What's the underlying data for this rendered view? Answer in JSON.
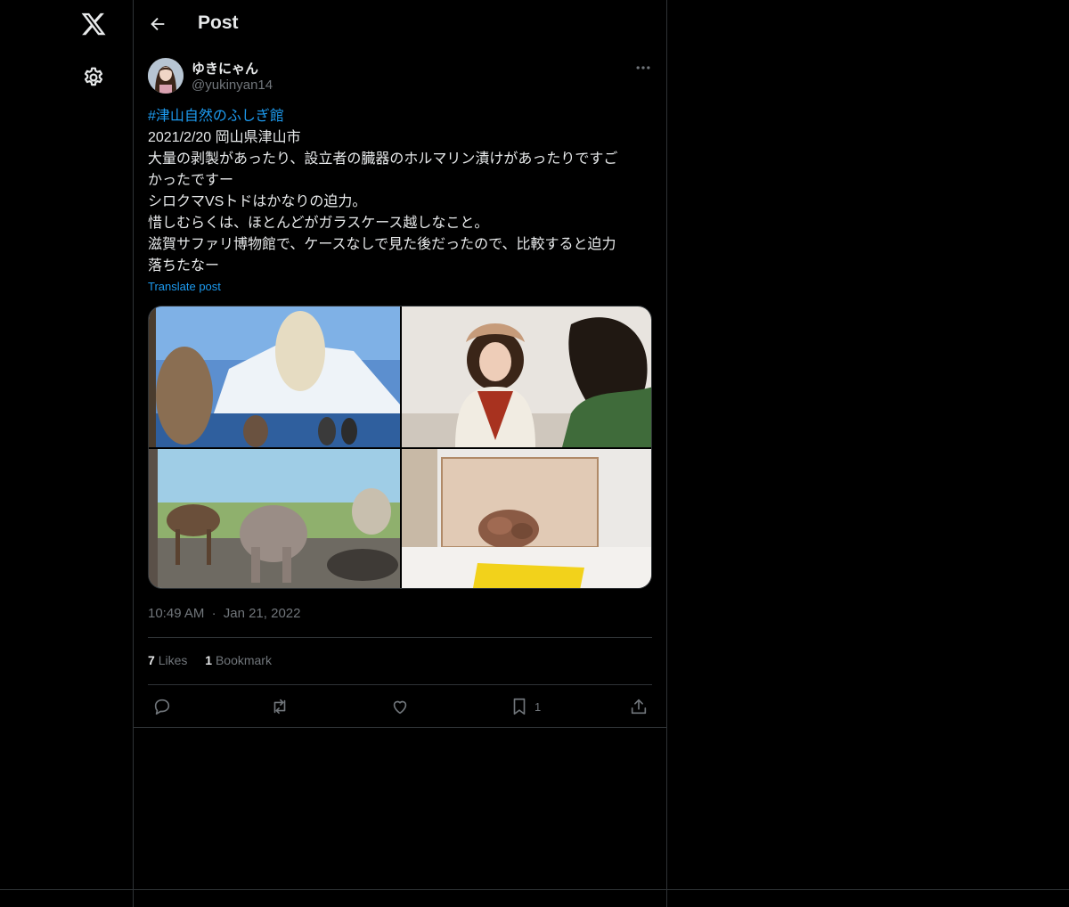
{
  "header": {
    "title": "Post"
  },
  "author": {
    "display_name": "ゆきにゃん",
    "handle": "@yukinyan14"
  },
  "post": {
    "hashtag": "#津山自然のふしぎ館",
    "lines": [
      "2021/2/20 岡山県津山市",
      "大量の剥製があったり、設立者の臓器のホルマリン漬けがあったりですご",
      "かったですー",
      "シロクマVSトドはかなりの迫力。",
      "惜しむらくは、ほとんどがガラスケース越しなこと。",
      "滋賀サファリ博物館で、ケースなしで見た後だったので、比較すると迫力",
      "落ちたなー"
    ],
    "translate_label": "Translate post",
    "time": "10:49 AM",
    "separator": "·",
    "date": "Jan 21, 2022"
  },
  "stats": {
    "likes_count": "7",
    "likes_label": "Likes",
    "bookmarks_count": "1",
    "bookmarks_label": "Bookmark"
  },
  "actions": {
    "bookmark_count": "1"
  },
  "icons": {
    "logo": "x-logo-icon",
    "settings": "gear-icon",
    "back": "arrow-left-icon",
    "more": "more-dots-icon",
    "reply": "reply-icon",
    "repost": "repost-icon",
    "like": "heart-icon",
    "bookmark": "bookmark-icon",
    "share": "share-icon"
  },
  "colors": {
    "background": "#000000",
    "text": "#e7e9ea",
    "muted": "#71767b",
    "link": "#1d9bf0",
    "border": "#2f3336"
  }
}
